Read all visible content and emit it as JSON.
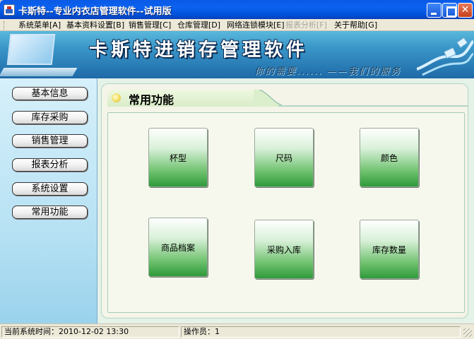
{
  "window": {
    "title": "卡斯特--专业内衣店管理软件--试用版",
    "min_glyph": "",
    "max_glyph": "",
    "close_glyph": "✕"
  },
  "menu": {
    "items": [
      {
        "label": "系统菜单[A]",
        "enabled": true
      },
      {
        "label": "基本资料设置[B]",
        "enabled": true
      },
      {
        "label": "销售管理[C]",
        "enabled": true
      },
      {
        "label": "仓库管理[D]",
        "enabled": true
      },
      {
        "label": "网络连锁模块[E]",
        "enabled": true
      },
      {
        "label": "报表分析[F]",
        "enabled": false
      },
      {
        "label": "关于帮助[G]",
        "enabled": true
      }
    ]
  },
  "banner": {
    "title": "卡斯特进销存管理软件",
    "slogan": "你的需要...... ——我们的服务"
  },
  "sidebar": {
    "items": [
      {
        "label": "基本信息"
      },
      {
        "label": "库存采购"
      },
      {
        "label": "销售管理"
      },
      {
        "label": "报表分析"
      },
      {
        "label": "系统设置"
      },
      {
        "label": "常用功能"
      }
    ]
  },
  "panel": {
    "title": "常用功能",
    "buttons": [
      {
        "label": "杯型"
      },
      {
        "label": "尺码"
      },
      {
        "label": "颜色"
      },
      {
        "label": "商品档案"
      },
      {
        "label": "采购入库"
      },
      {
        "label": "库存数量"
      }
    ]
  },
  "status": {
    "time_text": "当前系统时间：2010-12-02 13:30",
    "operator_text": "操作员：1"
  },
  "colors": {
    "title_bar": "#0b62f0",
    "banner": "#3a96c8",
    "button_green": "#2e9a3a",
    "sidebar": "#b8e2f4"
  }
}
